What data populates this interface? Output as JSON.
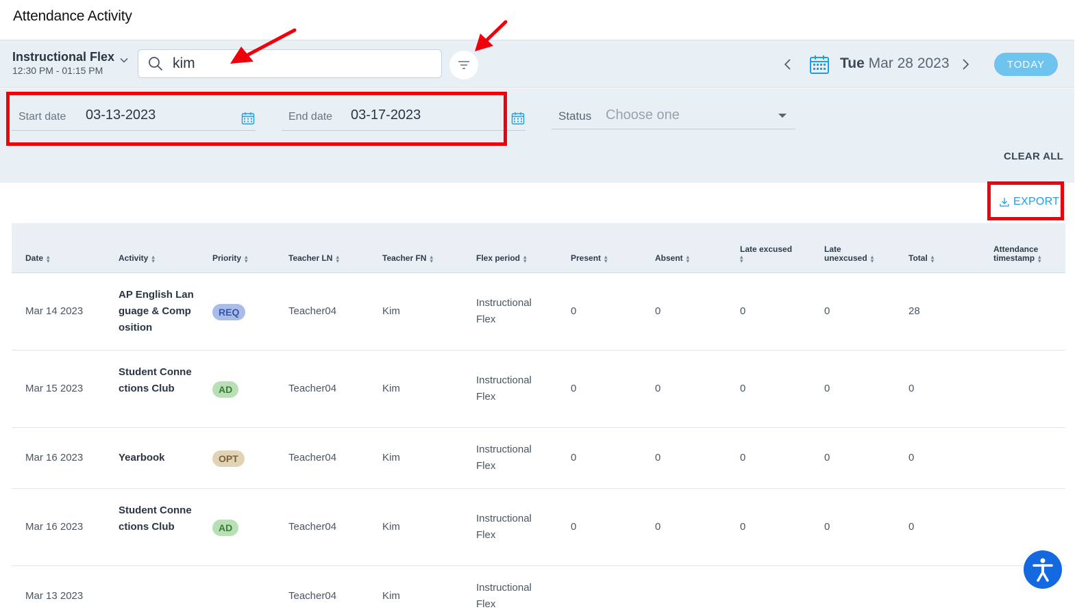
{
  "page": {
    "title": "Attendance Activity"
  },
  "toolbar": {
    "period_name": "Instructional Flex",
    "period_time": "12:30 PM - 01:15 PM",
    "search_value": "kim",
    "date_day": "Tue",
    "date_rest": "Mar 28 2023",
    "today_label": "TODAY"
  },
  "filters": {
    "start_label": "Start date",
    "start_value": "03-13-2023",
    "end_label": "End date",
    "end_value": "03-17-2023",
    "status_label": "Status",
    "status_placeholder": "Choose one",
    "clear_all_label": "CLEAR ALL"
  },
  "export_label": "EXPORT",
  "table": {
    "headers": [
      "Date",
      "Activity",
      "Priority",
      "Teacher LN",
      "Teacher FN",
      "Flex period",
      "Present",
      "Absent",
      "Late excused",
      "Late unexcused",
      "Total",
      "Attendance timestamp"
    ],
    "rows": [
      {
        "date": "Mar 14 2023",
        "activity": "AP English Language & Composition",
        "priority": "REQ",
        "teacher_ln": "Teacher04",
        "teacher_fn": "Kim",
        "flex_period": "Instructional Flex",
        "present": "0",
        "absent": "0",
        "late_excused": "0",
        "late_unexcused": "0",
        "total": "28",
        "timestamp": ""
      },
      {
        "date": "Mar 15 2023",
        "activity": "Student Connections Club",
        "priority": "AD",
        "teacher_ln": "Teacher04",
        "teacher_fn": "Kim",
        "flex_period": "Instructional Flex",
        "present": "0",
        "absent": "0",
        "late_excused": "0",
        "late_unexcused": "0",
        "total": "0",
        "timestamp": ""
      },
      {
        "date": "Mar 16 2023",
        "activity": "Yearbook",
        "priority": "OPT",
        "teacher_ln": "Teacher04",
        "teacher_fn": "Kim",
        "flex_period": "Instructional Flex",
        "present": "0",
        "absent": "0",
        "late_excused": "0",
        "late_unexcused": "0",
        "total": "0",
        "timestamp": ""
      },
      {
        "date": "Mar 16 2023",
        "activity": "Student Connections Club",
        "priority": "AD",
        "teacher_ln": "Teacher04",
        "teacher_fn": "Kim",
        "flex_period": "Instructional Flex",
        "present": "0",
        "absent": "0",
        "late_excused": "0",
        "late_unexcused": "0",
        "total": "0",
        "timestamp": ""
      },
      {
        "date": "Mar 13 2023",
        "activity": "",
        "priority": "",
        "teacher_ln": "Teacher04",
        "teacher_fn": "Kim",
        "flex_period": "Instructional Flex",
        "present": "",
        "absent": "",
        "late_excused": "",
        "late_unexcused": "",
        "total": "",
        "timestamp": ""
      }
    ]
  },
  "colors": {
    "accent": "#1e9ee6",
    "today_button": "#6ec3ef",
    "annotation_red": "#f0000a",
    "badge_req_bg": "#a9bce8",
    "badge_req_fg": "#3a55a8",
    "badge_ad_bg": "#b8e0b4",
    "badge_ad_fg": "#3a7a3a",
    "badge_opt_bg": "#e0d3b6",
    "badge_opt_fg": "#7a6238"
  }
}
